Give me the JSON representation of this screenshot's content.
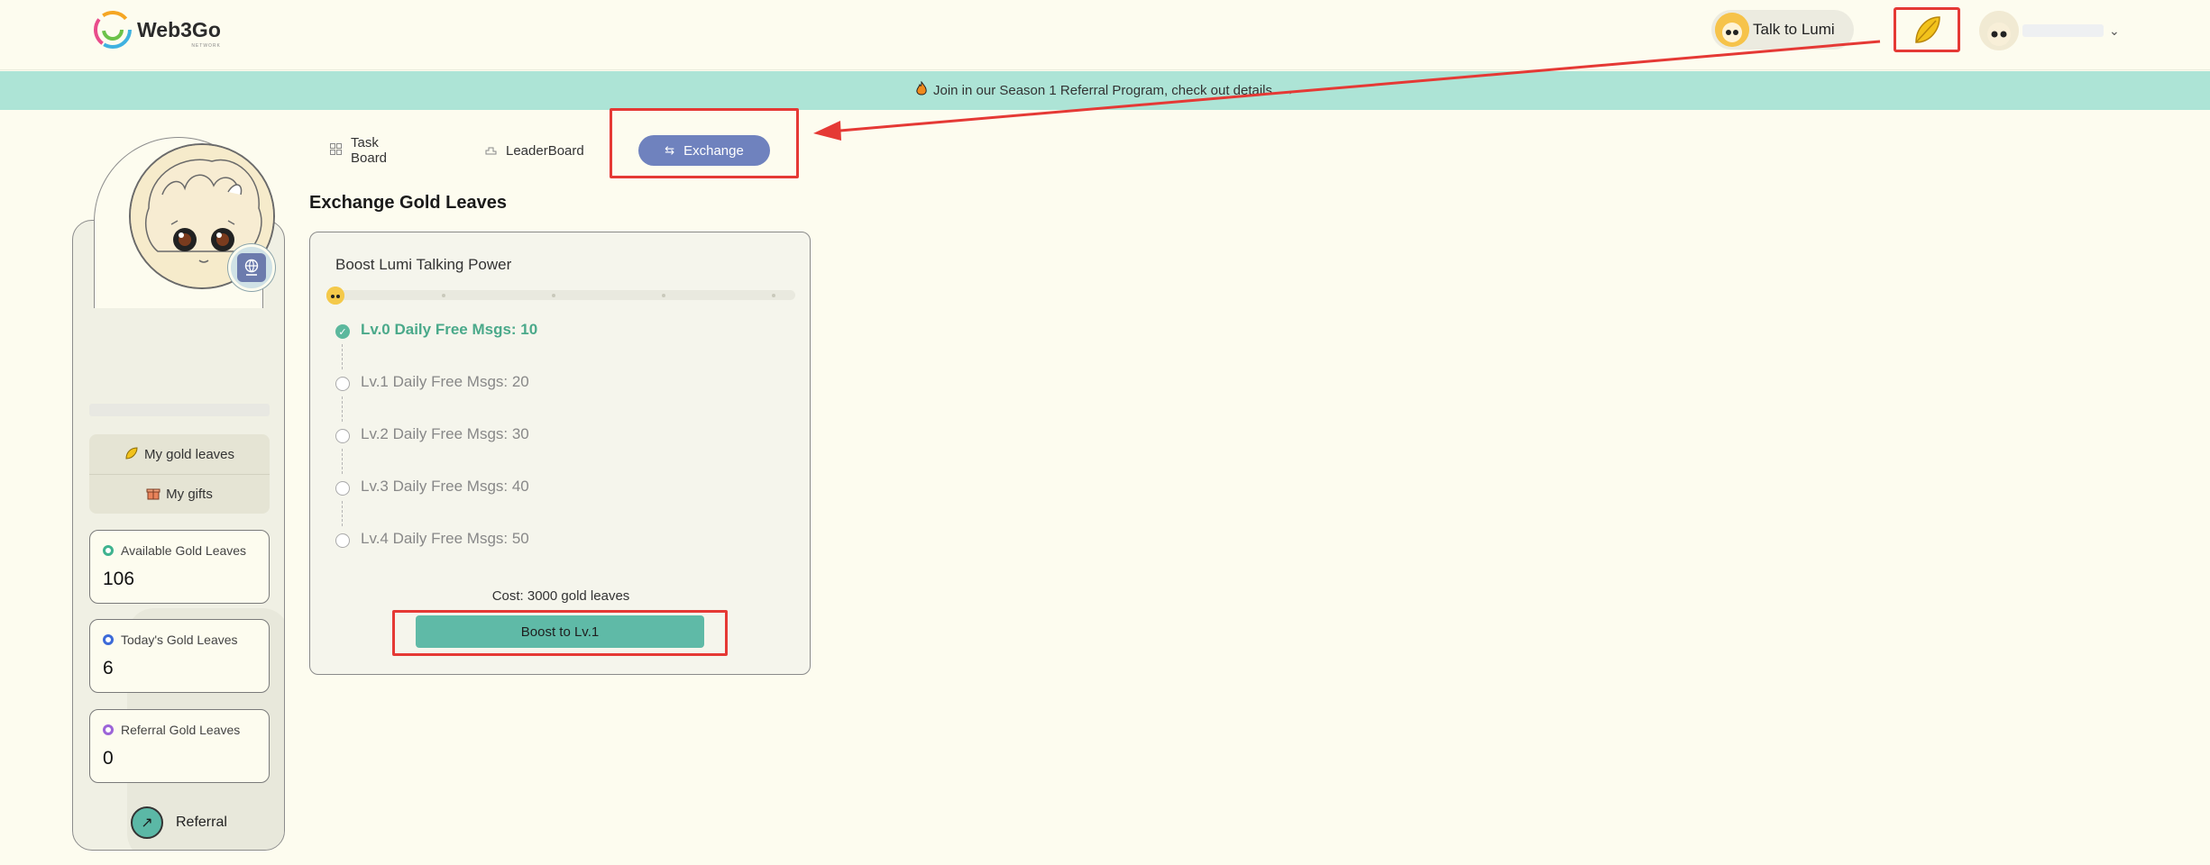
{
  "header": {
    "logo_text": "Web3Go",
    "logo_sub": "NETWORK",
    "talk_label": "Talk to Lumi"
  },
  "banner": {
    "text": "Join in our Season 1 Referral Program, check out details",
    "arrow": "→",
    "icon": "fire-icon"
  },
  "sidebar": {
    "menu": [
      {
        "label": "My gold leaves",
        "icon": "leaf-icon"
      },
      {
        "label": "My gifts",
        "icon": "gift-icon"
      }
    ],
    "stats": [
      {
        "label": "Available Gold Leaves",
        "value": "106",
        "color": "#3fb38f"
      },
      {
        "label": "Today's Gold Leaves",
        "value": "6",
        "color": "#3c6ad8"
      },
      {
        "label": "Referral Gold Leaves",
        "value": "0",
        "color": "#9c64d8"
      }
    ],
    "referral_label": "Referral",
    "referral_icon": "↗",
    "socials": [
      "mail-icon",
      "twitter-icon",
      "discord-icon"
    ]
  },
  "tabs": [
    {
      "label": "Task Board",
      "icon": "grid-icon",
      "active": false
    },
    {
      "label": "LeaderBoard",
      "icon": "podium-icon",
      "active": true
    },
    {
      "label": "Exchange",
      "icon": "exchange-icon",
      "active": true
    }
  ],
  "main": {
    "title": "Exchange Gold Leaves",
    "card_title": "Boost Lumi Talking Power",
    "levels": [
      {
        "label": "Lv.0 Daily Free Msgs: 10",
        "done": true
      },
      {
        "label": "Lv.1 Daily Free Msgs: 20",
        "done": false
      },
      {
        "label": "Lv.2 Daily Free Msgs: 30",
        "done": false
      },
      {
        "label": "Lv.3 Daily Free Msgs: 40",
        "done": false
      },
      {
        "label": "Lv.4 Daily Free Msgs: 50",
        "done": false
      }
    ],
    "cost": "Cost: 3000 gold leaves",
    "boost_button": "Boost to Lv.1"
  },
  "colors": {
    "accent": "#5fbaa7",
    "tab_active": "#6f82be",
    "banner": "#ade4d6",
    "annotation": "#e53935"
  }
}
